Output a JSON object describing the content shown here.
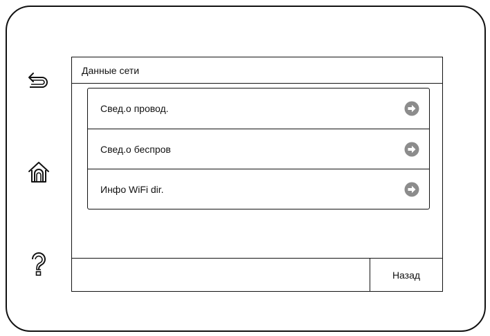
{
  "screen": {
    "title": "Данные сети"
  },
  "menu": {
    "items": [
      {
        "label": "Свед.о провод.",
        "icon": "arrow-right-circle-icon"
      },
      {
        "label": "Свед.о беспров",
        "icon": "arrow-right-circle-icon"
      },
      {
        "label": "Инфо WiFi dir.",
        "icon": "arrow-right-circle-icon"
      }
    ]
  },
  "footer": {
    "back_label": "Назад"
  },
  "side_icons": {
    "back": "back-icon",
    "home": "home-icon",
    "help": "help-icon"
  },
  "colors": {
    "outline": "#111111",
    "background": "#ffffff",
    "arrow_fill": "#8c8c8c"
  }
}
